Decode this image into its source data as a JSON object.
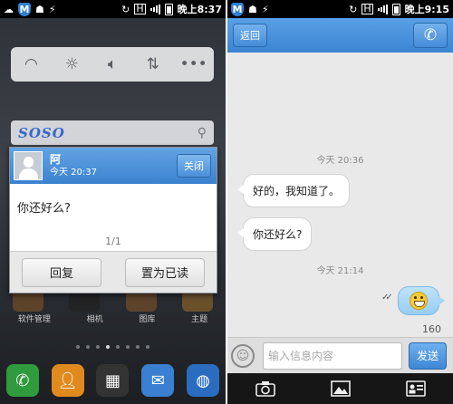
{
  "left_screen": {
    "statusbar": {
      "clock": "晚上8:37",
      "network": "H"
    },
    "soso": {
      "logo": "SOSO"
    },
    "popup": {
      "contact_name": "阿",
      "time": "今天 20:37",
      "close_label": "关闭",
      "message": "你还好么?",
      "page_indicator": "1/1",
      "reply_label": "回复",
      "mark_read_label": "置为已读"
    },
    "home_labels": [
      "软件管理",
      "相机",
      "图库",
      "主题"
    ]
  },
  "right_screen": {
    "statusbar": {
      "clock": "晚上9:15",
      "network": "H"
    },
    "header": {
      "back_label": "返回",
      "title": ""
    },
    "messages": [
      {
        "timestamp": "今天 20:36",
        "text": "好的，我知道了。"
      },
      {
        "text": "你还好么?"
      },
      {
        "timestamp": "今天 21:14"
      }
    ],
    "char_count": "160",
    "composer": {
      "placeholder": "输入信息内容",
      "send_label": "发送"
    },
    "toolbar_icons": [
      "camera-icon",
      "image-icon",
      "contact-card-icon"
    ]
  },
  "colors": {
    "accent": "#3b84d2",
    "bubble_out": "#a8d6f5"
  }
}
